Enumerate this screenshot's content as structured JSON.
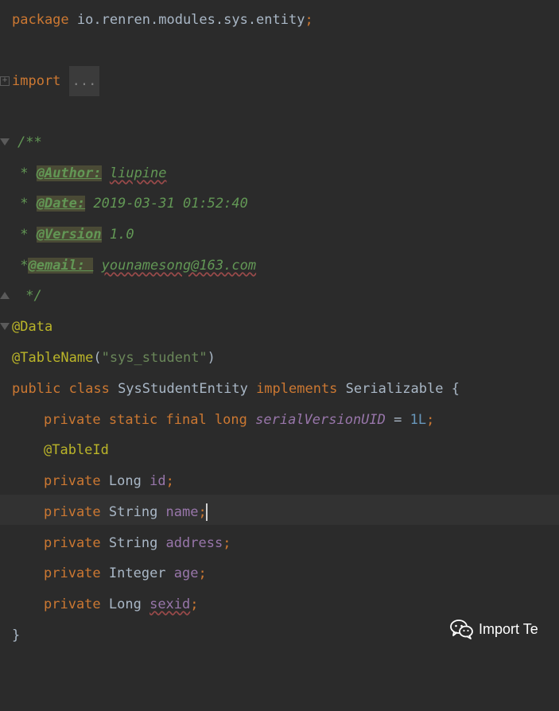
{
  "editor": {
    "package_kw": "package",
    "package_name": " io.renren.modules.sys.entity",
    "semicolon": ";",
    "import_kw": "import",
    "import_fold": "...",
    "doc_open": "/**",
    "doc_author_star": " * ",
    "doc_author_tag": "@Author:",
    "doc_author_val": "liupine",
    "doc_date_star": " * ",
    "doc_date_tag": "@Date:",
    "doc_date_val": " 2019-03-31 01:52:40",
    "doc_version_star": " * ",
    "doc_version_tag": "@Version",
    "doc_version_val": " 1.0",
    "doc_email_star": " *",
    "doc_email_tag": "@email: ",
    "doc_email_val": "younamesong@163.com",
    "doc_close": " */",
    "ann_data": "@Data",
    "ann_tablename": "@TableName",
    "tablename_open": "(",
    "tablename_str": "\"sys_student\"",
    "tablename_close": ")",
    "class_kw": "public class",
    "class_name": " SysStudentEntity ",
    "implements_kw": "implements",
    "interface_name": " Serializable {",
    "serial_kw": "private static final long",
    "serial_field": "serialVersionUID",
    "serial_eq": " = ",
    "serial_val": "1L",
    "ann_tableid": "@TableId",
    "private_kw": "private",
    "type_long": " Long ",
    "type_string": " String ",
    "type_integer": " Integer ",
    "field_id": "id",
    "field_name": "name",
    "field_address": "address",
    "field_age": "age",
    "field_sexid": "sexid",
    "close_brace": "}"
  },
  "watermark": {
    "text": "Import Te",
    "icon": "wechat-icon"
  },
  "colors": {
    "background": "#2b2b2b",
    "current_line": "#323232",
    "keyword": "#cc7832",
    "string": "#6a8759",
    "annotation": "#bbb529",
    "field": "#9876aa",
    "number": "#6897bb",
    "doc": "#629755"
  }
}
